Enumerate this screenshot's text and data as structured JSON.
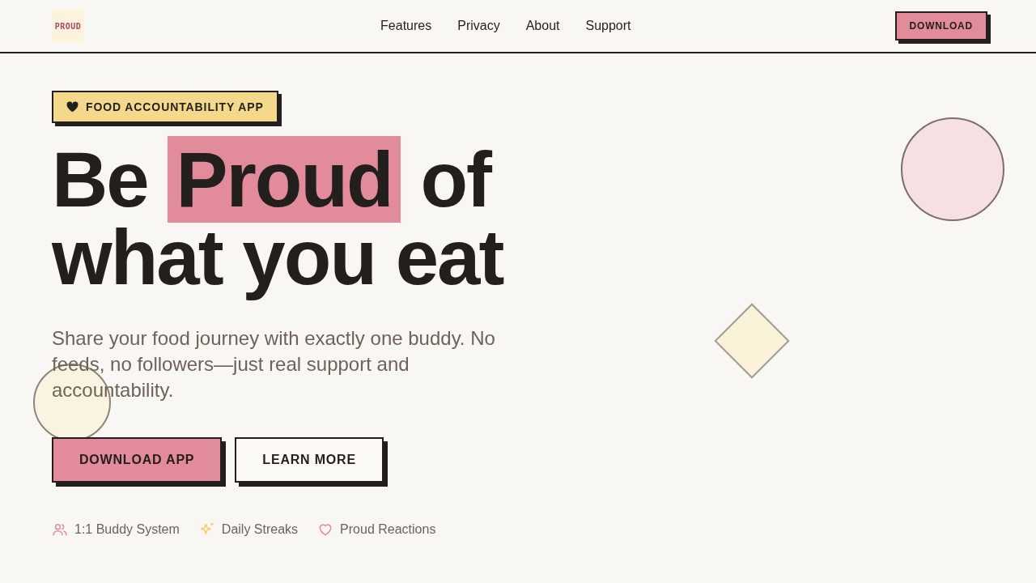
{
  "header": {
    "logo": "PROUD",
    "nav": [
      "Features",
      "Privacy",
      "About",
      "Support"
    ],
    "download": "DOWNLOAD"
  },
  "hero": {
    "badge": "FOOD ACCOUNTABILITY APP",
    "headline": [
      {
        "text": "Be ",
        "highlight": false
      },
      {
        "text": "Proud",
        "highlight": true
      },
      {
        "text": " of what you eat",
        "highlight": false
      }
    ],
    "subtitle": "Share your food journey with exactly one buddy. No feeds, no followers—just real support and accountability.",
    "buttons": [
      {
        "label": "DOWNLOAD APP",
        "kind": "primary"
      },
      {
        "label": "LEARN MORE",
        "kind": "secondary"
      }
    ],
    "features": [
      {
        "label": "1:1 Buddy System",
        "kind": "buddy"
      },
      {
        "label": "Daily Streaks",
        "kind": "streak"
      },
      {
        "label": "Proud Reactions",
        "kind": "reaction"
      }
    ]
  }
}
